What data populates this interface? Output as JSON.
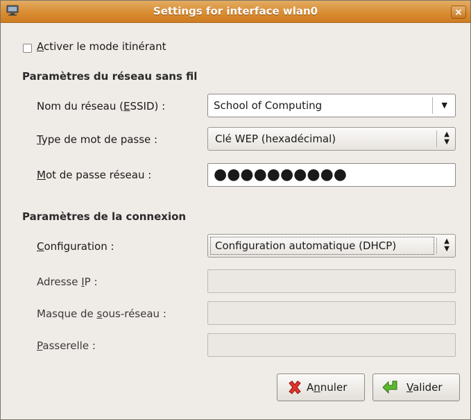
{
  "window": {
    "title": "Settings for interface wlan0",
    "close_label": "×"
  },
  "roaming": {
    "checked": false,
    "label_prefix": "",
    "label_mnemonic": "A",
    "label_rest": "ctiver le mode itinérant"
  },
  "wireless": {
    "heading": "Paramètres du réseau sans fil",
    "essid_label_pre": "Nom du réseau (",
    "essid_label_mn": "E",
    "essid_label_post": "SSID) :",
    "essid_value": "School of Computing",
    "pwtype_label_mn": "T",
    "pwtype_label_post": "ype de mot de passe :",
    "pwtype_value": "Clé WEP (hexadécimal)",
    "password_label_mn": "M",
    "password_label_post": "ot de passe réseau :",
    "password_value": "●●●●●●●●●●"
  },
  "connection": {
    "heading": "Paramètres de la connexion",
    "config_label_mn": "C",
    "config_label_post": "onfiguration :",
    "config_value": "Configuration automatique (DHCP)",
    "ip_label_pre": "Adresse ",
    "ip_label_mn": "I",
    "ip_label_post": "P :",
    "ip_value": "",
    "mask_label_pre": "Masque de ",
    "mask_label_mn": "s",
    "mask_label_post": "ous-réseau :",
    "mask_value": "",
    "gw_label_mn": "P",
    "gw_label_post": "asserelle :",
    "gw_value": ""
  },
  "buttons": {
    "cancel_pre": "A",
    "cancel_mn": "n",
    "cancel_post": "nuler",
    "ok_mn": "V",
    "ok_post": "alider"
  },
  "colors": {
    "titlebar": "#d98b2f",
    "window_bg": "#efebe7"
  }
}
